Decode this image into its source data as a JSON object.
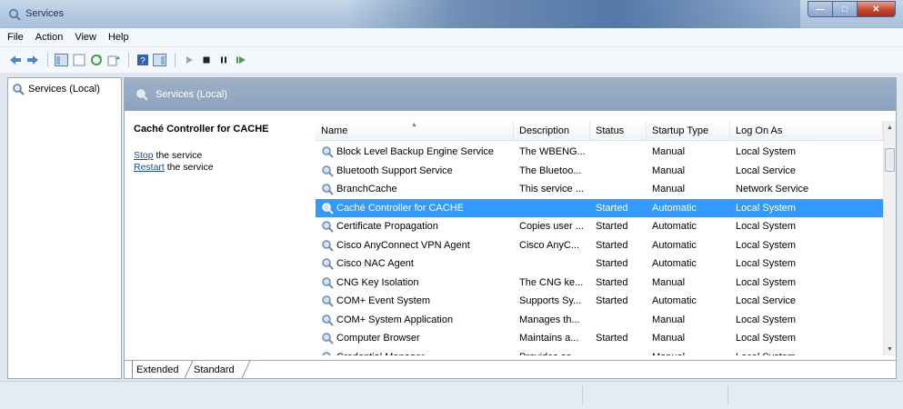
{
  "window": {
    "title": "Services"
  },
  "menu": {
    "items": [
      "File",
      "Action",
      "View",
      "Help"
    ]
  },
  "toolbar": {
    "buttons": [
      "back-icon",
      "forward-icon",
      "show-hide-console-tree-icon",
      "properties-icon",
      "refresh-icon",
      "export-list-icon",
      "help-icon",
      "show-action-pane-icon",
      "start-service-icon",
      "stop-service-icon",
      "pause-service-icon",
      "restart-service-icon"
    ]
  },
  "tree": {
    "root_label": "Services (Local)"
  },
  "pane_header": {
    "title": "Services (Local)"
  },
  "detail": {
    "service_title": "Caché Controller for CACHE",
    "stop_link": "Stop",
    "stop_rest": " the service",
    "restart_link": "Restart",
    "restart_rest": " the service"
  },
  "columns": {
    "name": "Name",
    "description": "Description",
    "status": "Status",
    "startup": "Startup Type",
    "logon": "Log On As"
  },
  "services": [
    {
      "name": "Block Level Backup Engine Service",
      "description": "The WBENG...",
      "status": "",
      "startup": "Manual",
      "logon": "Local System",
      "selected": false
    },
    {
      "name": "Bluetooth Support Service",
      "description": "The Bluetoo...",
      "status": "",
      "startup": "Manual",
      "logon": "Local Service",
      "selected": false
    },
    {
      "name": "BranchCache",
      "description": "This service ...",
      "status": "",
      "startup": "Manual",
      "logon": "Network Service",
      "selected": false
    },
    {
      "name": "Caché Controller for CACHE",
      "description": "",
      "status": "Started",
      "startup": "Automatic",
      "logon": "Local System",
      "selected": true
    },
    {
      "name": "Certificate Propagation",
      "description": "Copies user ...",
      "status": "Started",
      "startup": "Automatic",
      "logon": "Local System",
      "selected": false
    },
    {
      "name": "Cisco AnyConnect VPN Agent",
      "description": "Cisco AnyC...",
      "status": "Started",
      "startup": "Automatic",
      "logon": "Local System",
      "selected": false
    },
    {
      "name": "Cisco NAC Agent",
      "description": "",
      "status": "Started",
      "startup": "Automatic",
      "logon": "Local System",
      "selected": false
    },
    {
      "name": "CNG Key Isolation",
      "description": "The CNG ke...",
      "status": "Started",
      "startup": "Manual",
      "logon": "Local System",
      "selected": false
    },
    {
      "name": "COM+ Event System",
      "description": "Supports Sy...",
      "status": "Started",
      "startup": "Automatic",
      "logon": "Local Service",
      "selected": false
    },
    {
      "name": "COM+ System Application",
      "description": "Manages th...",
      "status": "",
      "startup": "Manual",
      "logon": "Local System",
      "selected": false
    },
    {
      "name": "Computer Browser",
      "description": "Maintains a...",
      "status": "Started",
      "startup": "Manual",
      "logon": "Local System",
      "selected": false
    },
    {
      "name": "Credential Manager",
      "description": "Provides se...",
      "status": "",
      "startup": "Manual",
      "logon": "Local System",
      "selected": false
    }
  ],
  "tabs": {
    "extended": "Extended",
    "standard": "Standard"
  }
}
